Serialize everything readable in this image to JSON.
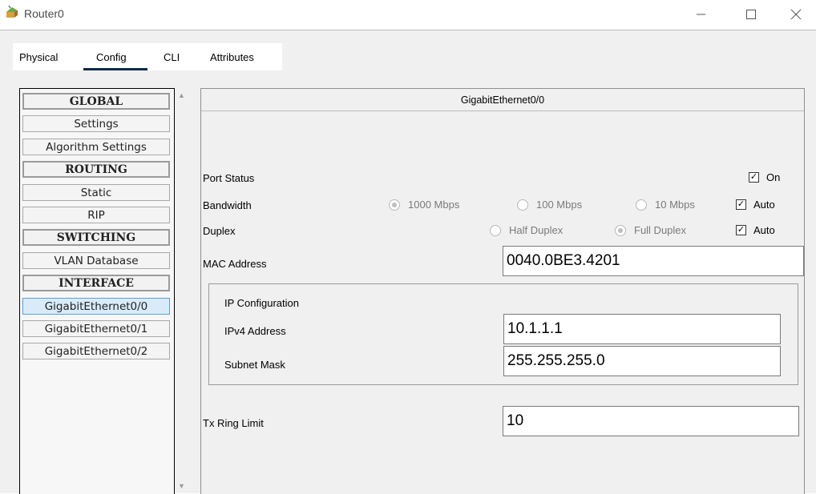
{
  "window": {
    "title": "Router0"
  },
  "tabs": [
    {
      "label": "Physical"
    },
    {
      "label": "Config"
    },
    {
      "label": "CLI"
    },
    {
      "label": "Attributes"
    }
  ],
  "active_tab": "Config",
  "sidebar": {
    "items": [
      {
        "label": "GLOBAL"
      },
      {
        "label": "Settings"
      },
      {
        "label": "Algorithm Settings"
      },
      {
        "label": "ROUTING"
      },
      {
        "label": "Static"
      },
      {
        "label": "RIP"
      },
      {
        "label": "SWITCHING"
      },
      {
        "label": "VLAN Database"
      },
      {
        "label": "INTERFACE"
      },
      {
        "label": "GigabitEthernet0/0"
      },
      {
        "label": "GigabitEthernet0/1"
      },
      {
        "label": "GigabitEthernet0/2"
      }
    ],
    "selected": "GigabitEthernet0/0"
  },
  "interface": {
    "title": "GigabitEthernet0/0",
    "port_status_label": "Port Status",
    "port_on_label": "On",
    "port_on_checked": true,
    "bandwidth_label": "Bandwidth",
    "bandwidth_options": [
      "1000 Mbps",
      "100 Mbps",
      "10 Mbps"
    ],
    "bandwidth_selected": "1000 Mbps",
    "bandwidth_auto_label": "Auto",
    "bandwidth_auto_checked": true,
    "duplex_label": "Duplex",
    "duplex_options": [
      "Half Duplex",
      "Full Duplex"
    ],
    "duplex_selected": "Full Duplex",
    "duplex_auto_label": "Auto",
    "duplex_auto_checked": true,
    "mac_label": "MAC Address",
    "mac_value": "0040.0BE3.4201",
    "ip_config_title": "IP Configuration",
    "ipv4_label": "IPv4 Address",
    "ipv4_value": "10.1.1.1",
    "subnet_label": "Subnet Mask",
    "subnet_value": "255.255.255.0",
    "tx_label": "Tx Ring Limit",
    "tx_value": "10"
  },
  "colors": {
    "accent": "#0b2a4a",
    "selected_bg": "#d9ebf9",
    "selected_border": "#5aa0d8"
  }
}
